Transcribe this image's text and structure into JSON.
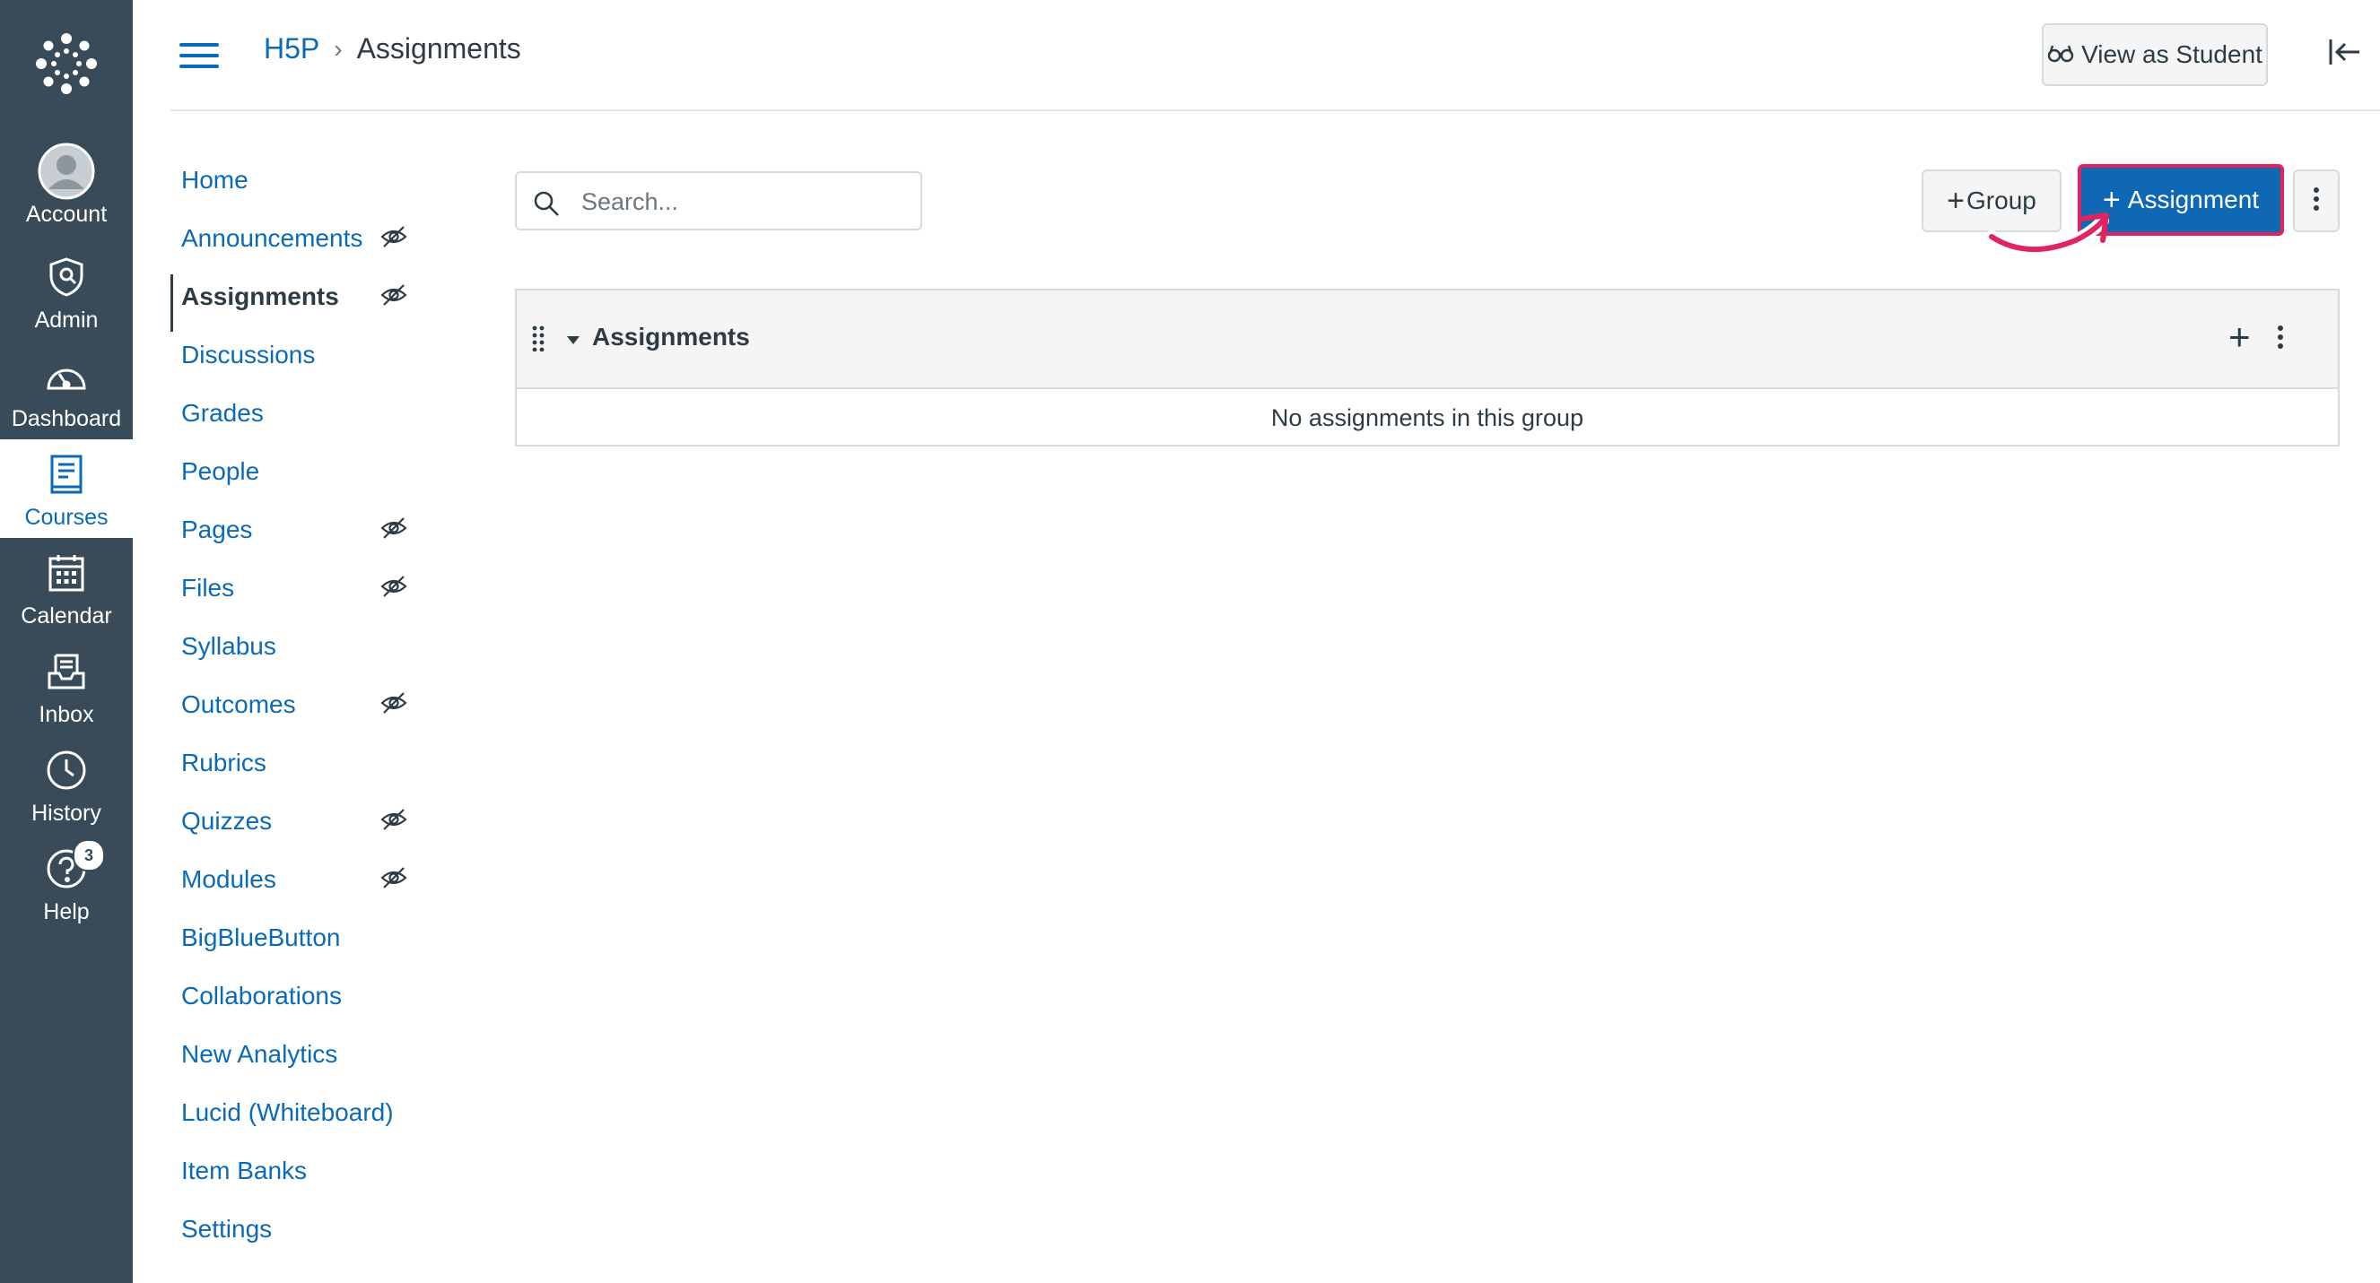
{
  "global_nav": {
    "items": [
      {
        "label": "Account",
        "icon": "account-avatar-icon"
      },
      {
        "label": "Admin",
        "icon": "admin-shield-icon"
      },
      {
        "label": "Dashboard",
        "icon": "dashboard-gauge-icon"
      },
      {
        "label": "Courses",
        "icon": "courses-book-icon",
        "active": true
      },
      {
        "label": "Calendar",
        "icon": "calendar-icon"
      },
      {
        "label": "Inbox",
        "icon": "inbox-icon"
      },
      {
        "label": "History",
        "icon": "history-clock-icon"
      },
      {
        "label": "Help",
        "icon": "help-question-icon",
        "badge": "3"
      }
    ]
  },
  "header": {
    "breadcrumb": [
      "H5P",
      "Assignments"
    ],
    "separator": "›",
    "view_as_student": "View as Student"
  },
  "course_nav": {
    "items": [
      {
        "label": "Home",
        "hidden": false
      },
      {
        "label": "Announcements",
        "hidden": true
      },
      {
        "label": "Assignments",
        "hidden": true,
        "active": true
      },
      {
        "label": "Discussions",
        "hidden": false
      },
      {
        "label": "Grades",
        "hidden": false
      },
      {
        "label": "People",
        "hidden": false
      },
      {
        "label": "Pages",
        "hidden": true
      },
      {
        "label": "Files",
        "hidden": true
      },
      {
        "label": "Syllabus",
        "hidden": false
      },
      {
        "label": "Outcomes",
        "hidden": true
      },
      {
        "label": "Rubrics",
        "hidden": false
      },
      {
        "label": "Quizzes",
        "hidden": true
      },
      {
        "label": "Modules",
        "hidden": true
      },
      {
        "label": "BigBlueButton",
        "hidden": false
      },
      {
        "label": "Collaborations",
        "hidden": false
      },
      {
        "label": "New Analytics",
        "hidden": false
      },
      {
        "label": "Lucid (Whiteboard)",
        "hidden": false
      },
      {
        "label": "Item Banks",
        "hidden": false
      },
      {
        "label": "Settings",
        "hidden": false
      }
    ]
  },
  "toolbar": {
    "search_placeholder": "Search...",
    "group_label": "Group",
    "assignment_label": "Assignment"
  },
  "assignment_group": {
    "title": "Assignments",
    "empty_text": "No assignments in this group"
  },
  "colors": {
    "nav_bg": "#394b58",
    "link": "#0b6ab7",
    "primary_button": "#0e68b3",
    "highlight": "#e0245e"
  }
}
